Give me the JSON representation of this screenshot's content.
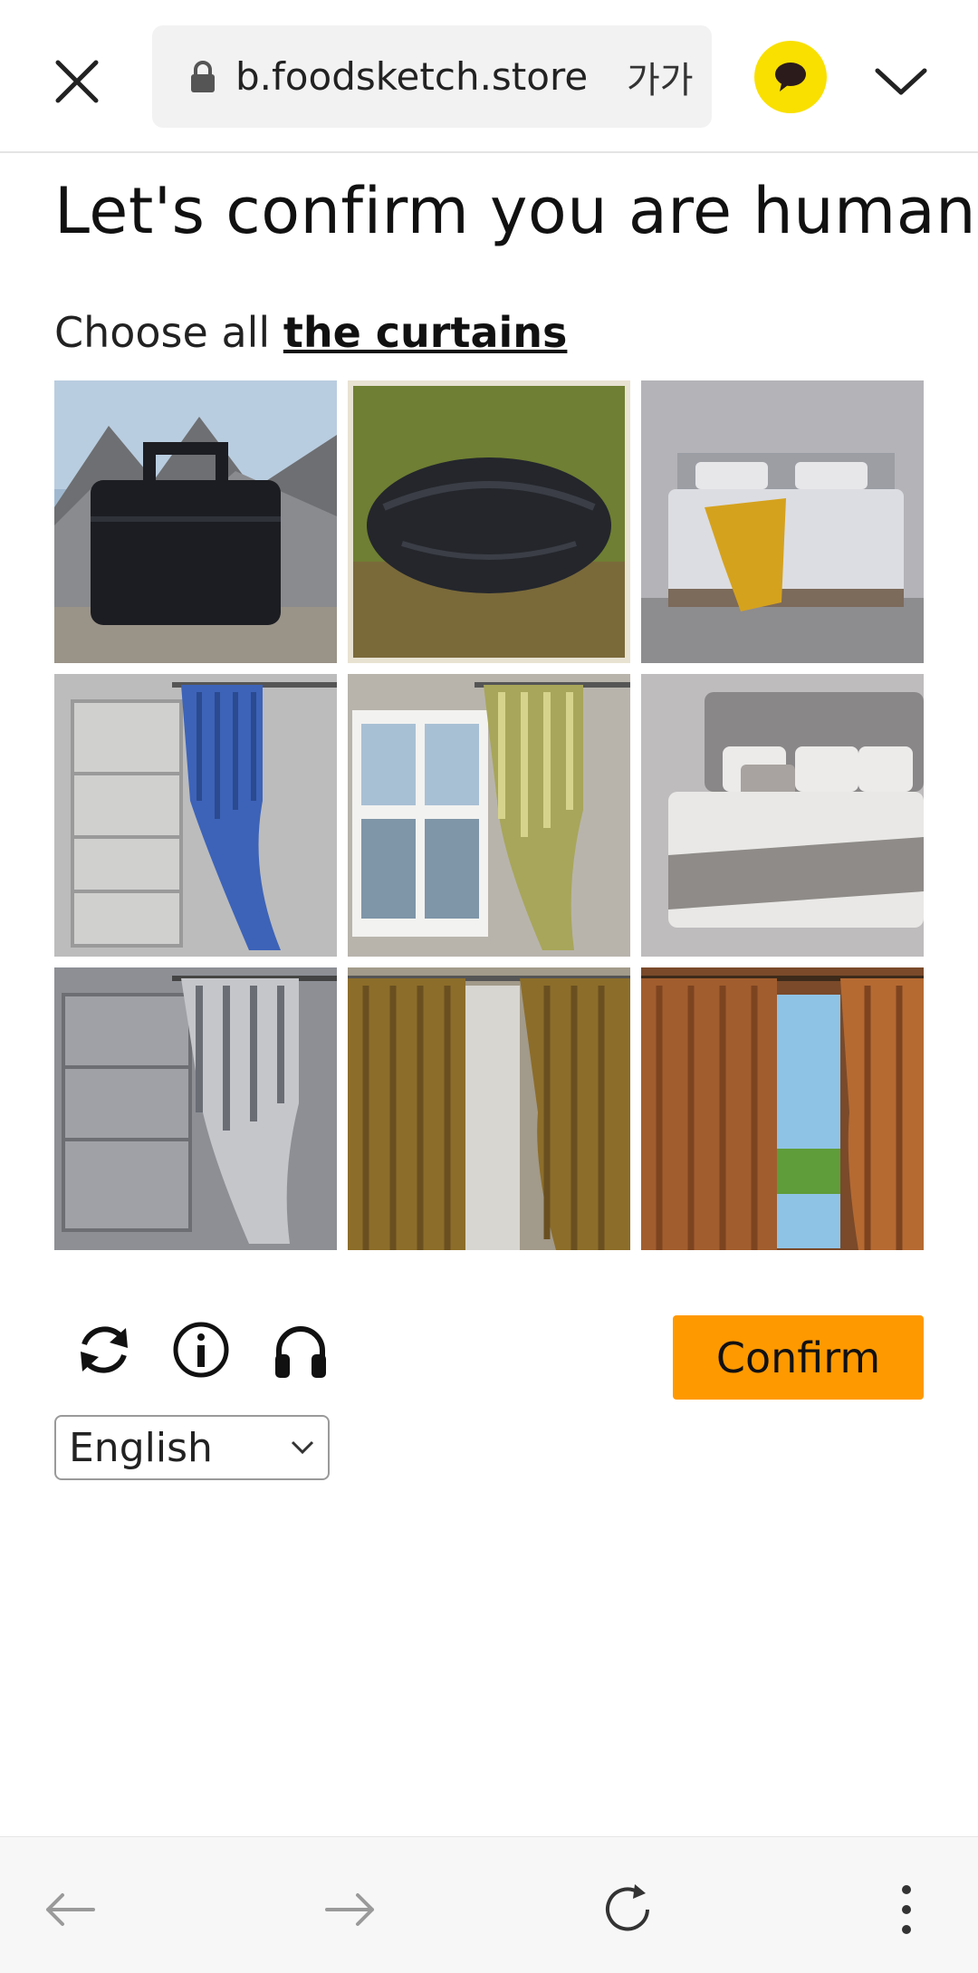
{
  "browser": {
    "url": "b.foodsketch.store",
    "reader_mode_label": "가가",
    "icons": {
      "close": "close-icon",
      "lock": "lock-icon",
      "kakao": "kakao-talk-icon",
      "menu": "chevron-down-icon"
    }
  },
  "captcha": {
    "title": "Let's confirm you are human",
    "instruction_prefix": "Choose all ",
    "instruction_target": "the curtains",
    "tiles": [
      {
        "label": "black bag on mountain rocks"
      },
      {
        "label": "black bag on grass"
      },
      {
        "label": "bed with yellow throw"
      },
      {
        "label": "blue curtain by window"
      },
      {
        "label": "green striped curtain by window"
      },
      {
        "label": "bed with grey pillows"
      },
      {
        "label": "grey striped curtain"
      },
      {
        "label": "brown curtains on window"
      },
      {
        "label": "orange curtains open to sky"
      }
    ],
    "controls": {
      "refresh_icon": "refresh-icon",
      "info_icon": "info-icon",
      "audio_icon": "headphones-icon",
      "confirm_label": "Confirm"
    },
    "language": {
      "selected": "English"
    },
    "accent_color": "#ff9900"
  },
  "bottom_nav": {
    "icons": [
      "back-arrow-icon",
      "forward-arrow-icon",
      "reload-icon",
      "more-vert-icon"
    ]
  }
}
